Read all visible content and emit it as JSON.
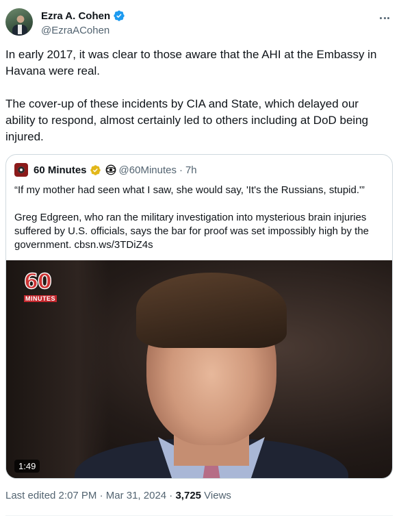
{
  "author": {
    "name": "Ezra A. Cohen",
    "handle": "@EzraACohen",
    "verified_color": "#1d9bf0"
  },
  "tweet": {
    "paragraphs": [
      "In early 2017, it was clear to those aware that the AHI at the Embassy in Havana were real.",
      "The cover-up of these incidents by CIA and State, which delayed our ability to respond, almost certainly led to others including at DoD being injured."
    ]
  },
  "quote": {
    "name": "60 Minutes",
    "handle": "@60Minutes",
    "separator": "·",
    "time": "7h",
    "verified_color": "#e2b719",
    "paragraphs": [
      "“If my mother had seen what I saw, she would say, 'It's the Russians, stupid.'”",
      "Greg Edgreen, who ran the military investigation into mysterious brain injuries suffered by U.S. officials, says the bar for proof was set impossibly high by the government. cbsn.ws/3TDiZ4s"
    ],
    "media": {
      "logo_number": "60",
      "logo_word": "MINUTES",
      "duration": "1:49"
    }
  },
  "footer": {
    "edited": "Last edited 2:07 PM · Mar 31, 2024 · ",
    "views_count": "3,725",
    "views_label": " Views"
  },
  "icons": {
    "more": "more-horizontal-icon",
    "verified": "verified-badge-icon",
    "cbs": "cbs-eye-icon"
  }
}
